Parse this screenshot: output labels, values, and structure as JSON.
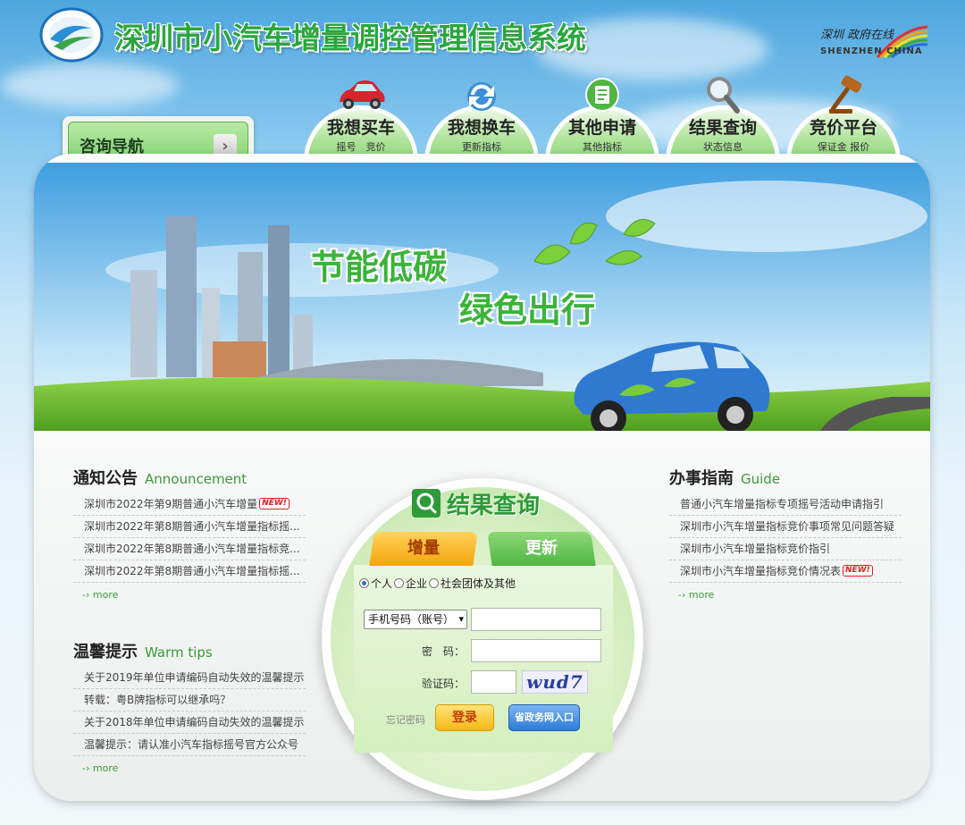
{
  "header": {
    "title": "深圳市小汽车增量调控管理信息系统",
    "shenzhen_cn": "深圳 政府在线",
    "shenzhen_en": "SHENZHEN CHINA"
  },
  "consult_nav": {
    "label": "咨询导航"
  },
  "top_tabs": [
    {
      "title": "我想买车",
      "subtitle": "摇号　竞价",
      "icon": "car-icon"
    },
    {
      "title": "我想换车",
      "subtitle": "更新指标",
      "icon": "refresh-icon"
    },
    {
      "title": "其他申请",
      "subtitle": "其他指标",
      "icon": "document-icon"
    },
    {
      "title": "结果查询",
      "subtitle": "状态信息",
      "icon": "magnifier-icon"
    },
    {
      "title": "竞价平台",
      "subtitle": "保证金  报价",
      "icon": "gavel-icon"
    }
  ],
  "banner": {
    "slogan_line1": "节能低碳",
    "slogan_line2": "绿色出行"
  },
  "announcement": {
    "title": "通知公告",
    "subtitle": "Announcement",
    "items": [
      {
        "text": "深圳市2022年第9期普通小汽车增量",
        "new": true
      },
      {
        "text": "深圳市2022年第8期普通小汽车增量指标摇...",
        "new": false
      },
      {
        "text": "深圳市2022年第8期普通小汽车增量指标竞...",
        "new": false
      },
      {
        "text": "深圳市2022年第8期普通小汽车增量指标摇...",
        "new": false
      }
    ],
    "more": "more"
  },
  "warm_tips": {
    "title": "温馨提示",
    "subtitle": "Warm tips",
    "items": [
      {
        "text": "关于2019年单位申请编码自动失效的温馨提示"
      },
      {
        "text": "转载：粤B牌指标可以继承吗？"
      },
      {
        "text": "关于2018年单位申请编码自动失效的温馨提示"
      },
      {
        "text": "温馨提示：请认准小汽车指标摇号官方公众号"
      }
    ],
    "more": "more"
  },
  "guide": {
    "title": "办事指南",
    "subtitle": "Guide",
    "items": [
      {
        "text": "普通小汽车增量指标专项摇号活动申请指引",
        "new": false
      },
      {
        "text": "深圳市小汽车增量指标竞价事项常见问题答疑",
        "new": false
      },
      {
        "text": "深圳市小汽车增量指标竞价指引",
        "new": false
      },
      {
        "text": "深圳市小汽车增量指标竞价情况表",
        "new": true
      }
    ],
    "more": "more"
  },
  "new_badge": "NEW!",
  "result_query": {
    "title": "结果查询",
    "tab_active": "增量",
    "tab_inactive": "更新",
    "radios": [
      "个人",
      "企业",
      "社会团体及其他"
    ],
    "radio_selected": "个人",
    "select_value": "手机号码（账号）",
    "password_label": "密　码：",
    "captcha_label": "验证码：",
    "captcha_text": "wud7",
    "forgot": "忘记密码",
    "login": "登录",
    "gov_entry": "省政务网入口"
  }
}
